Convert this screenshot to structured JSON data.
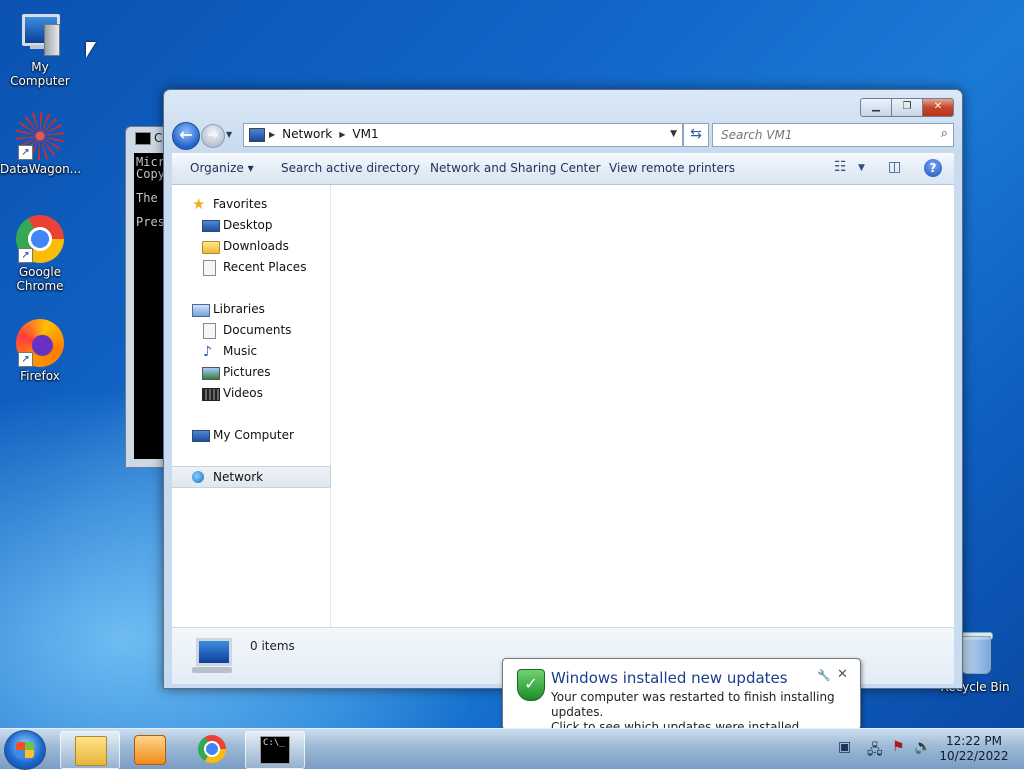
{
  "desktop": {
    "icons": [
      {
        "label": "My Computer",
        "icon": "computer-icon"
      },
      {
        "label": "DataWagon...",
        "icon": "datawagon-icon"
      },
      {
        "label": "Google Chrome",
        "icon": "chrome-icon"
      },
      {
        "label": "Firefox",
        "icon": "firefox-icon"
      },
      {
        "label": "Recycle Bin",
        "icon": "recycle-bin-icon"
      }
    ]
  },
  "cmd_window": {
    "title": "C",
    "lines": [
      "Micr",
      "Copy",
      "",
      "The ",
      "",
      "Pres"
    ]
  },
  "explorer": {
    "address": {
      "crumbs": [
        "Network",
        "VM1"
      ]
    },
    "search": {
      "placeholder": "Search VM1"
    },
    "toolbar": {
      "organize": "Organize",
      "organize_arrow": "▾",
      "search_ad": "Search active directory",
      "network_sharing": "Network and Sharing Center",
      "view_printers": "View remote printers",
      "help": "?"
    },
    "nav": {
      "favorites": "Favorites",
      "desktop": "Desktop",
      "downloads": "Downloads",
      "recent": "Recent Places",
      "libraries": "Libraries",
      "documents": "Documents",
      "music": "Music",
      "pictures": "Pictures",
      "videos": "Videos",
      "my_computer": "My Computer",
      "network": "Network"
    },
    "status": {
      "count": "0 items"
    }
  },
  "notification": {
    "title": "Windows installed new updates",
    "line1": "Your computer was restarted to finish installing updates.",
    "line2": "Click to see which updates were installed."
  },
  "taskbar": {
    "clock_time": "12:22 PM",
    "clock_date": "10/22/2022",
    "terminal_glyph": "C:\\_"
  }
}
